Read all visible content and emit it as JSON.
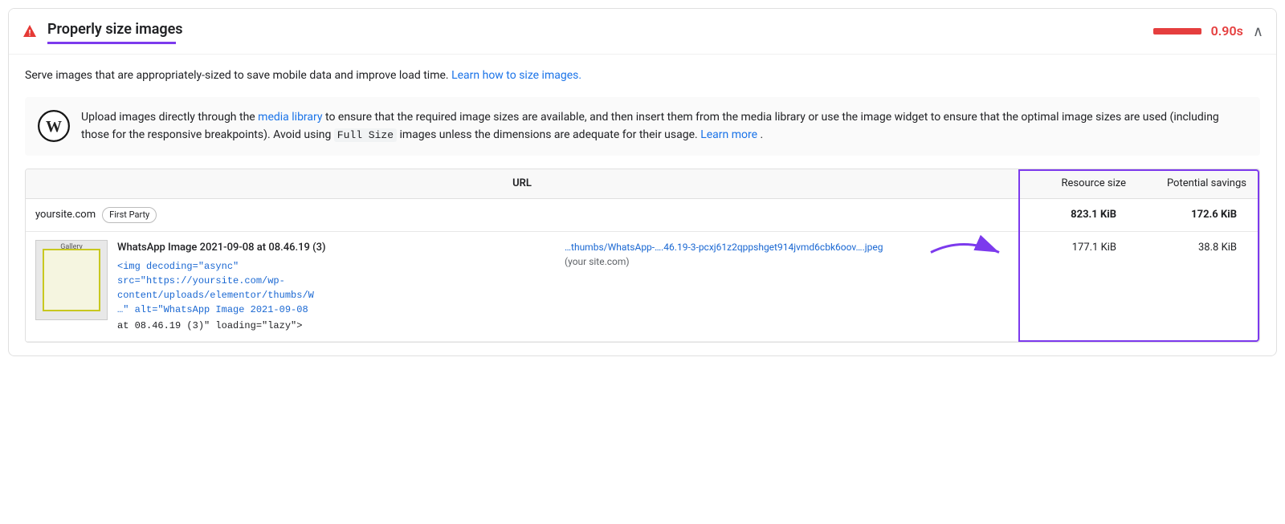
{
  "panel": {
    "title": "Properly size images",
    "warning_icon": "▲",
    "score": "0.90s",
    "score_bar_color": "#e53e3e",
    "chevron": "∧"
  },
  "description": {
    "text": "Serve images that are appropriately-sized to save mobile data and improve load time.",
    "link_text": "Learn how to size images.",
    "link_url": "#"
  },
  "wp_note": {
    "text_before": "Upload images directly through the",
    "link1_text": "media library",
    "text_middle1": "to ensure that the required image sizes are available, and then insert them from the media library or use the image widget to ensure that the optimal image sizes are used (including those for the responsive breakpoints). Avoid using",
    "code_text": "Full Size",
    "text_middle2": "images unless the dimensions are adequate for their usage.",
    "link2_text": "Learn more",
    "text_end": "."
  },
  "table": {
    "col_url": "URL",
    "col_resource": "Resource size",
    "col_savings": "Potential savings",
    "group": {
      "domain": "yoursite.com",
      "badge": "First Party",
      "resource_size": "823.1 KiB",
      "potential_savings": "172.6 KiB"
    },
    "rows": [
      {
        "title": "WhatsApp Image 2021-09-08 at 08.46.19 (3)",
        "code_line1": "<img decoding=\"async\"",
        "code_line2": "src=\"https://yoursite.com/wp-",
        "code_line3": "content/uploads/elementor/thumbs/W",
        "code_line4": "…\" alt=\"WhatsApp Image 2021-09-08",
        "alt_line": "at 08.46.19 (3)\" loading=\"lazy\">",
        "url_display": "…thumbs/WhatsApp-….46.19-3-pcxj61z2qppshget914jvmd6cbk6oov….jpeg",
        "url_site": "(your site.com)",
        "resource_size": "177.1 KiB",
        "potential_savings": "38.8 KiB",
        "thumbnail_label": "Gallery"
      }
    ]
  }
}
